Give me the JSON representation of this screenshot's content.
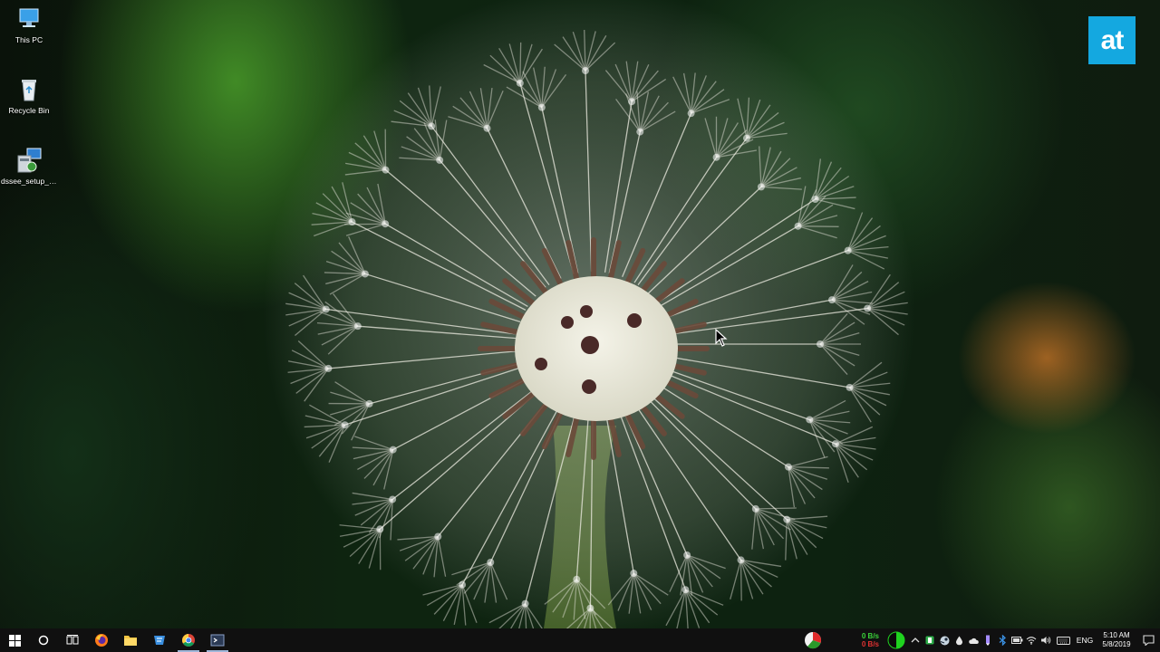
{
  "desktop": {
    "icons": [
      {
        "label": "This PC",
        "icon": "this-pc-icon"
      },
      {
        "label": "Recycle Bin",
        "icon": "recycle-bin-icon"
      },
      {
        "label": "dssee_setup_x6...",
        "icon": "installer-icon"
      }
    ],
    "brand_logo": "at"
  },
  "taskbar": {
    "apps": [
      {
        "name": "start",
        "icon": "windows-logo-icon"
      },
      {
        "name": "search",
        "icon": "cortana-circle-icon"
      },
      {
        "name": "task-view",
        "icon": "task-view-icon"
      },
      {
        "name": "firefox",
        "icon": "firefox-icon"
      },
      {
        "name": "file-explorer",
        "icon": "folder-icon"
      },
      {
        "name": "app",
        "icon": "blue-app-icon"
      },
      {
        "name": "chrome",
        "icon": "chrome-icon"
      },
      {
        "name": "terminal",
        "icon": "terminal-icon"
      }
    ],
    "tray": {
      "net_up": "0 B/s",
      "net_down": "0 B/s",
      "language": "ENG",
      "time": "5:10 AM",
      "date": "5/8/2019"
    }
  },
  "colors": {
    "taskbar_bg": "#101010",
    "brand_blue": "#14a8e0",
    "net_up_green": "#3ad23a",
    "net_down_red": "#e03232"
  }
}
